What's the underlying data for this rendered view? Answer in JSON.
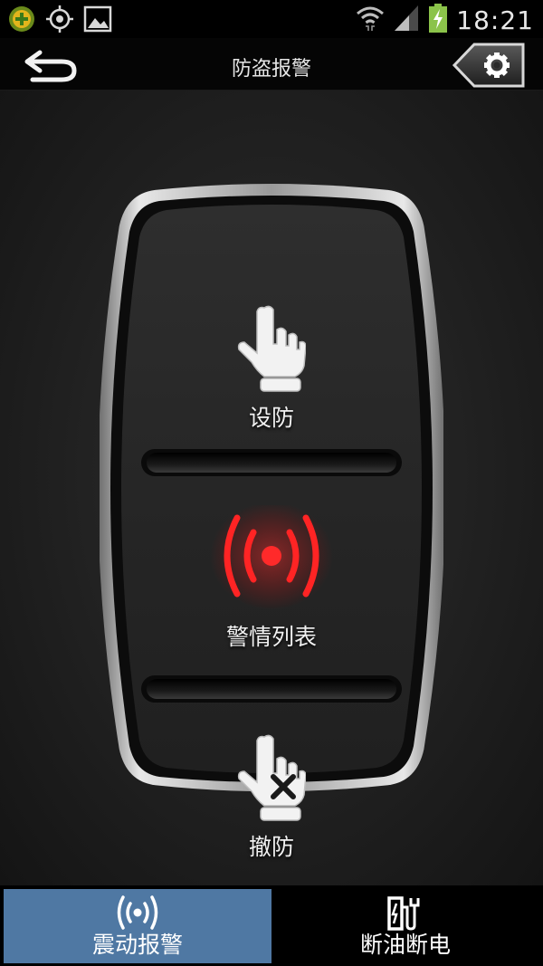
{
  "status_bar": {
    "time": "18:21",
    "icons": [
      "app-badge-icon",
      "gps-icon",
      "gallery-icon",
      "wifi-icon",
      "signal-icon",
      "battery-charging-icon"
    ]
  },
  "header": {
    "title": "防盗报警",
    "back_icon": "back-arrow-icon",
    "settings_icon": "gear-icon"
  },
  "remote": {
    "arm_label": "设防",
    "alarm_list_label": "警情列表",
    "disarm_label": "撤防",
    "arm_icon": "hand-pointer-icon",
    "alarm_icon": "alarm-signal-icon",
    "disarm_icon": "hand-pointer-cancel-icon",
    "alarm_color": "#e81c1c"
  },
  "bottom_nav": {
    "tabs": [
      {
        "label": "震动报警",
        "icon": "vibration-signal-icon",
        "active": true
      },
      {
        "label": "断油断电",
        "icon": "fuel-power-cut-icon",
        "active": false
      }
    ],
    "active_color": "#4f78a3"
  }
}
